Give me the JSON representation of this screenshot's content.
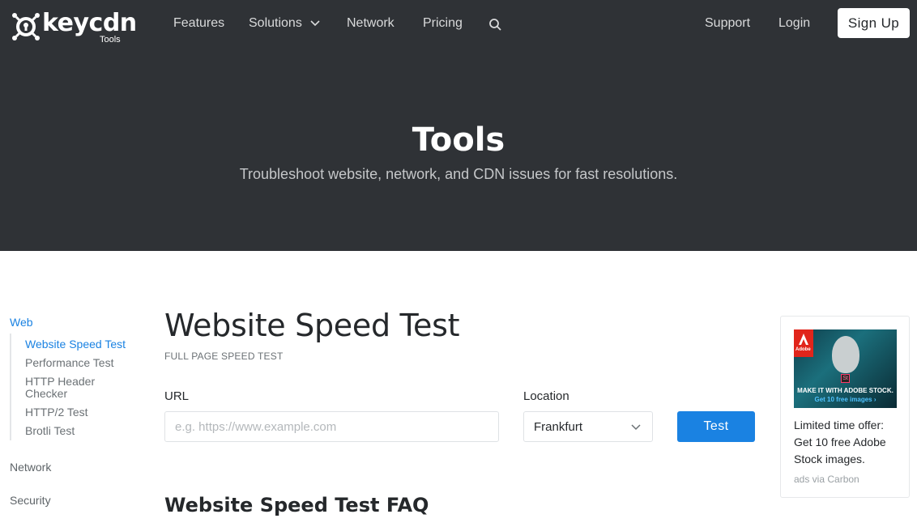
{
  "brand": {
    "name": "keycdn",
    "sub": "Tools"
  },
  "nav": {
    "features": "Features",
    "solutions": "Solutions",
    "network": "Network",
    "pricing": "Pricing",
    "support": "Support",
    "login": "Login",
    "signup": "Sign Up"
  },
  "hero": {
    "title": "Tools",
    "subtitle": "Troubleshoot website, network, and CDN issues for fast resolutions."
  },
  "sidebar": {
    "groups": [
      "Web",
      "Network",
      "Security"
    ],
    "web_items": [
      "Website Speed Test",
      "Performance Test",
      "HTTP Header Checker",
      "HTTP/2 Test",
      "Brotli Test"
    ],
    "active_group": "Web",
    "active_item": "Website Speed Test"
  },
  "main": {
    "title": "Website Speed Test",
    "kicker": "FULL PAGE SPEED TEST",
    "url_label": "URL",
    "url_placeholder": "e.g. https://www.example.com",
    "url_value": "",
    "location_label": "Location",
    "location_value": "Frankfurt",
    "test_button": "Test",
    "faq_title": "Website Speed Test FAQ"
  },
  "ad": {
    "image_line1": "MAKE IT WITH ADOBE STOCK.",
    "image_line2": "Get 10 free images ›",
    "adobe_mark": "Adobe",
    "st_mark": "St",
    "text": "Limited time offer: Get 10 free Adobe Stock images.",
    "via": "ads via Carbon"
  },
  "colors": {
    "hero_bg": "#2f3236",
    "accent": "#1a82e2",
    "adobe_red": "#e1251b"
  },
  "icons": {
    "logo": "keycdn-logo-icon",
    "solutions_dropdown": "chevron-down-icon",
    "search": "search-icon",
    "location_dropdown": "chevron-down-icon"
  }
}
